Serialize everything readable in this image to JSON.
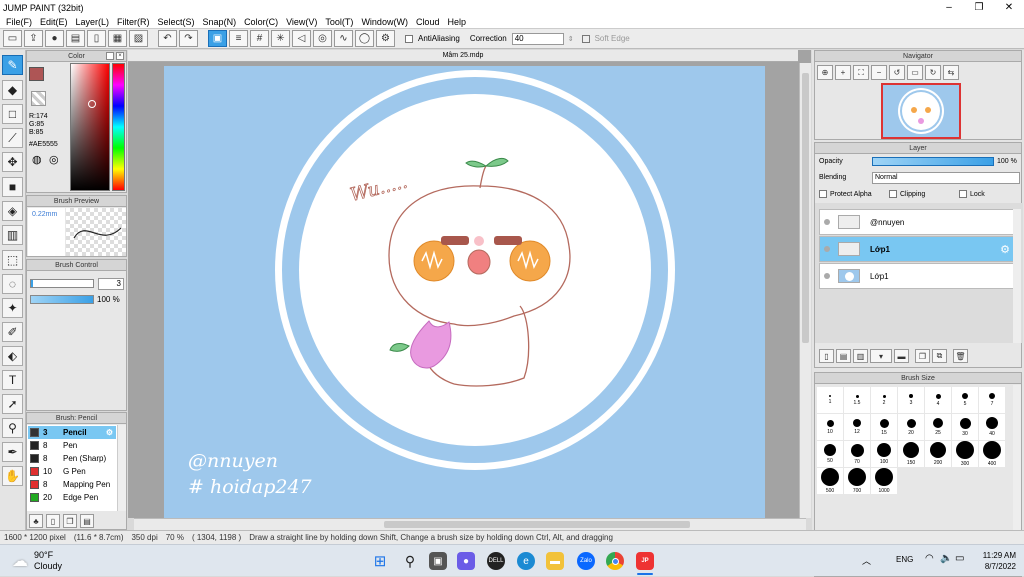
{
  "window": {
    "title": "JUMP PAINT (32bit)"
  },
  "menu": [
    "File(F)",
    "Edit(E)",
    "Layer(L)",
    "Filter(R)",
    "Select(S)",
    "Snap(N)",
    "Color(C)",
    "View(V)",
    "Tool(T)",
    "Window(W)",
    "Cloud",
    "Help"
  ],
  "toolbar": {
    "antialiasing_label": "AntiAliasing",
    "correction_label": "Correction",
    "correction_value": "40",
    "soft_edge_label": "Soft Edge"
  },
  "color_panel": {
    "title": "Color",
    "r": "R:174",
    "g": "G:85",
    "b": "B:85",
    "hex": "#AE5555",
    "fg_color": "#AE5555"
  },
  "brush_preview": {
    "title": "Brush Preview",
    "size": "0.22mm"
  },
  "brush_control": {
    "title": "Brush Control",
    "size_value": "3",
    "opacity_value": "100 %"
  },
  "brush_list": {
    "title": "Brush: Pencil",
    "items": [
      {
        "size": "3",
        "name": "Pencil",
        "color": "#333333",
        "selected": true
      },
      {
        "size": "8",
        "name": "Pen",
        "color": "#222222"
      },
      {
        "size": "8",
        "name": "Pen (Sharp)",
        "color": "#222222"
      },
      {
        "size": "10",
        "name": "G Pen",
        "color": "#e03030"
      },
      {
        "size": "8",
        "name": "Mapping Pen",
        "color": "#e03030"
      },
      {
        "size": "20",
        "name": "Edge Pen",
        "color": "#22aa22"
      }
    ]
  },
  "document": {
    "tab": "Mâm 25.mdp",
    "sketch_text": "Wu.....",
    "watermark1": "@nnuyen",
    "watermark2": "# hoidap247"
  },
  "status": {
    "size": "1600 * 1200 pixel",
    "cm": "(11.6 * 8.7cm)",
    "dpi": "350 dpi",
    "zoom": "70 %",
    "coords": "( 1304, 1198 )",
    "hint": "Draw a straight line by holding down Shift, Change a brush size by holding down Ctrl, Alt, and dragging"
  },
  "navigator": {
    "title": "Navigator"
  },
  "layer_panel": {
    "title": "Layer",
    "opacity_label": "Opacity",
    "opacity_value": "100 %",
    "blending_label": "Blending",
    "blending_value": "Normal",
    "protect_alpha": "Protect Alpha",
    "clipping": "Clipping",
    "lock": "Lock",
    "layers": [
      {
        "name": "@nnuyen",
        "selected": false
      },
      {
        "name": "Lớp1",
        "selected": true
      },
      {
        "name": "Lớp1",
        "selected": false
      }
    ]
  },
  "brush_size": {
    "title": "Brush Size",
    "sizes": [
      "1",
      "1.5",
      "2",
      "3",
      "4",
      "5",
      "7",
      "10",
      "12",
      "15",
      "20",
      "25",
      "30",
      "40",
      "50",
      "70",
      "100",
      "150",
      "200",
      "300",
      "400",
      "500",
      "700",
      "1000"
    ]
  },
  "taskbar": {
    "temp": "90°F",
    "weather": "Cloudy",
    "lang": "ENG",
    "time": "11:29 AM",
    "date": "8/7/2022"
  }
}
